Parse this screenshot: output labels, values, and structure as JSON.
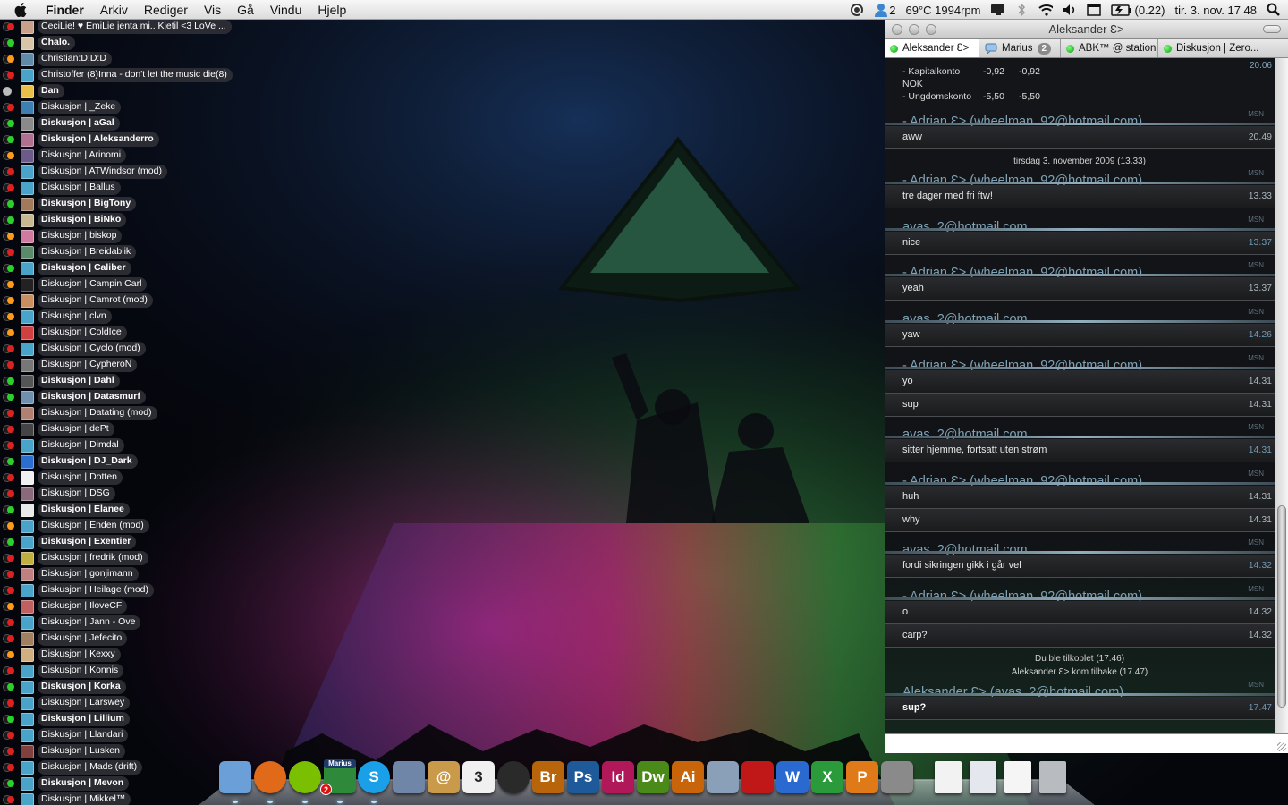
{
  "menubar": {
    "app_name": "Finder",
    "items": [
      "Arkiv",
      "Rediger",
      "Vis",
      "Gå",
      "Vindu",
      "Hjelp"
    ],
    "status": {
      "messages_count": "2",
      "temperature": "69°C 1994rpm",
      "battery": "(0.22)",
      "clock": "tir. 3. nov.  17 48"
    }
  },
  "buddies": [
    {
      "name": "CeciLie! ♥ EmiLie jenta mi.. Kjetil <3 LoVe ...",
      "status": "busy",
      "avatar": "#c9a18a"
    },
    {
      "name": "Chalo.",
      "status": "available",
      "bold": true,
      "avatar": "#d8c4a8"
    },
    {
      "name": "Christian:D:D:D",
      "status": "away",
      "avatar": "#5f8aa8"
    },
    {
      "name": "Christoffer (8)Inna - don't let the music die(8)",
      "status": "busy",
      "avatar": "#4aa3c9"
    },
    {
      "name": "Dan",
      "status": "offline",
      "bold": true,
      "avatar": "#e8c04a"
    },
    {
      "name": "Diskusjon | _Zeke",
      "status": "busy",
      "avatar": "#3d7fb0"
    },
    {
      "name": "Diskusjon | aGal",
      "status": "available",
      "bold": true,
      "avatar": "#8a8a8a"
    },
    {
      "name": "Diskusjon | Aleksanderro",
      "status": "available",
      "bold": true,
      "avatar": "#b07090"
    },
    {
      "name": "Diskusjon | Arinomi",
      "status": "away",
      "avatar": "#6b5a8a"
    },
    {
      "name": "Diskusjon | ATWindsor (mod)",
      "status": "busy",
      "avatar": "#4aa3c9"
    },
    {
      "name": "Diskusjon | Ballus",
      "status": "busy",
      "avatar": "#4aa3c9"
    },
    {
      "name": "Diskusjon | BigTony",
      "status": "available",
      "bold": true,
      "avatar": "#a07a5a"
    },
    {
      "name": "Diskusjon | BiNko",
      "status": "available",
      "bold": true,
      "avatar": "#c8b890"
    },
    {
      "name": "Diskusjon | biskop",
      "status": "away",
      "avatar": "#d07aa0"
    },
    {
      "name": "Diskusjon | Breidablik",
      "status": "busy",
      "avatar": "#5a8a6a"
    },
    {
      "name": "Diskusjon | Caliber",
      "status": "available",
      "bold": true,
      "avatar": "#4aa3c9"
    },
    {
      "name": "Diskusjon | Campin Carl",
      "status": "away",
      "avatar": "#222222"
    },
    {
      "name": "Diskusjon | Camrot (mod)",
      "status": "away",
      "avatar": "#c89060"
    },
    {
      "name": "Diskusjon | clvn",
      "status": "away",
      "avatar": "#4aa3c9"
    },
    {
      "name": "Diskusjon | ColdIce",
      "status": "away",
      "avatar": "#d04040"
    },
    {
      "name": "Diskusjon | Cyclo (mod)",
      "status": "busy",
      "avatar": "#4aa3c9"
    },
    {
      "name": "Diskusjon | CypheroN",
      "status": "busy",
      "avatar": "#777777"
    },
    {
      "name": "Diskusjon | Dahl",
      "status": "available",
      "bold": true,
      "avatar": "#555555"
    },
    {
      "name": "Diskusjon | Datasmurf",
      "status": "available",
      "bold": true,
      "avatar": "#7090b0"
    },
    {
      "name": "Diskusjon | Datating (mod)",
      "status": "busy",
      "avatar": "#b08070"
    },
    {
      "name": "Diskusjon | dePt",
      "status": "busy",
      "avatar": "#444444"
    },
    {
      "name": "Diskusjon | Dimdal",
      "status": "busy",
      "avatar": "#4aa3c9"
    },
    {
      "name": "Diskusjon | DJ_Dark",
      "status": "available",
      "bold": true,
      "avatar": "#2a6fd0"
    },
    {
      "name": "Diskusjon | Dotten",
      "status": "busy",
      "avatar": "#f0f0f0"
    },
    {
      "name": "Diskusjon | DSG",
      "status": "busy",
      "avatar": "#8a6a7a"
    },
    {
      "name": "Diskusjon | Elanee",
      "status": "available",
      "bold": true,
      "avatar": "#e8e8e8"
    },
    {
      "name": "Diskusjon | Enden (mod)",
      "status": "away",
      "avatar": "#4aa3c9"
    },
    {
      "name": "Diskusjon | Exentier",
      "status": "available",
      "bold": true,
      "avatar": "#4aa3c9"
    },
    {
      "name": "Diskusjon | fredrik (mod)",
      "status": "busy",
      "avatar": "#c0b040"
    },
    {
      "name": "Diskusjon | gonjimann",
      "status": "busy",
      "avatar": "#c08080"
    },
    {
      "name": "Diskusjon | Heilage (mod)",
      "status": "busy",
      "avatar": "#4aa3c9"
    },
    {
      "name": "Diskusjon | IloveCF",
      "status": "away",
      "avatar": "#c06060"
    },
    {
      "name": "Diskusjon | Jann - Ove",
      "status": "busy",
      "avatar": "#4aa3c9"
    },
    {
      "name": "Diskusjon | Jefecito",
      "status": "busy",
      "avatar": "#a08060"
    },
    {
      "name": "Diskusjon | Kexxy",
      "status": "away",
      "avatar": "#d0b080"
    },
    {
      "name": "Diskusjon | Konnis",
      "status": "busy",
      "avatar": "#4aa3c9"
    },
    {
      "name": "Diskusjon | Korka",
      "status": "available",
      "bold": true,
      "avatar": "#4aa3c9"
    },
    {
      "name": "Diskusjon | Larswey",
      "status": "busy",
      "avatar": "#4aa3c9"
    },
    {
      "name": "Diskusjon | Lillium",
      "status": "available",
      "bold": true,
      "avatar": "#4aa3c9"
    },
    {
      "name": "Diskusjon | Llandari",
      "status": "busy",
      "avatar": "#4aa3c9"
    },
    {
      "name": "Diskusjon | Lusken",
      "status": "busy",
      "avatar": "#804040"
    },
    {
      "name": "Diskusjon | Mads (drift)",
      "status": "busy",
      "avatar": "#4aa3c9"
    },
    {
      "name": "Diskusjon | Mevon",
      "status": "available",
      "bold": true,
      "avatar": "#4aa3c9"
    },
    {
      "name": "Diskusjon | Mikkel™",
      "status": "busy",
      "avatar": "#4aa3c9"
    }
  ],
  "status_colors": {
    "available": "#2bd12b",
    "away": "#ff9a1a",
    "busy": "#e02020",
    "offline": "#8a8a8a"
  },
  "chat": {
    "title": "Aleksander Ɛ>",
    "tabs": [
      {
        "label": "Aleksander Ɛ>",
        "active": true,
        "icon": "status-dot"
      },
      {
        "label": "Marius",
        "badge": "2",
        "icon": "speech-bubble-icon"
      },
      {
        "label": "ABK™ @ station",
        "icon": "status-dot"
      },
      {
        "label": "Diskusjon | Zero...",
        "icon": "status-dot"
      }
    ],
    "account_rows": [
      {
        "label": "- Kapitalkonto",
        "a": "-0,92",
        "b": "-0,92"
      },
      {
        "label": "NOK",
        "a": "",
        "b": ""
      },
      {
        "label": "- Ungdomskonto",
        "a": "-5,50",
        "b": "-5,50"
      }
    ],
    "first_time": "20.06",
    "date_divider": "tirsdag 3. november 2009 (13.33)",
    "protocol": "MSN",
    "sender_adrian": "- Adrian Ɛ> (wheelman_92@hotmail.com)",
    "sender_avas": "avas_2@hotmail.com",
    "sender_aleksander": "Aleksander Ɛ> (avas_2@hotmail.com)",
    "messages": [
      {
        "text": "aww",
        "time": "20.49"
      },
      {
        "text": "tre dager med fri ftw!",
        "time": "13.33"
      },
      {
        "text": "nice",
        "time": "13.37"
      },
      {
        "text": "yeah",
        "time": "13.37"
      },
      {
        "text": "yaw",
        "time": "14.26"
      },
      {
        "text": "yo",
        "time": "14.31"
      },
      {
        "text": "sup",
        "time": "14.31"
      },
      {
        "text": "sitter hjemme, fortsatt uten strøm",
        "time": "14.31"
      },
      {
        "text": "huh",
        "time": "14.31"
      },
      {
        "text": "why",
        "time": "14.31"
      },
      {
        "text": "fordi sikringen gikk i går vel",
        "time": "14.32"
      },
      {
        "text": "o",
        "time": "14.32"
      },
      {
        "text": "carp?",
        "time": "14.32"
      },
      {
        "text": "sup?",
        "time": "17.47"
      }
    ],
    "status_connected": "Du ble tilkoblet (17.46)",
    "status_back": "Aleksander Ɛ> kom tilbake (17.47)",
    "input_value": ""
  },
  "dock": {
    "apps": [
      {
        "name": "finder-icon",
        "label": "",
        "color": "#6a9fd8"
      },
      {
        "name": "firefox-icon",
        "label": "",
        "color": "#e06a1a"
      },
      {
        "name": "spotify-icon",
        "label": "",
        "color": "#7ac000"
      },
      {
        "name": "adium-icon",
        "label": "",
        "color": "#2e8a3a",
        "caption": "Marius",
        "badge": "2"
      },
      {
        "name": "skype-icon",
        "label": "S",
        "color": "#1aa0e8"
      },
      {
        "name": "preview-icon",
        "label": "",
        "color": "#6f86a8"
      },
      {
        "name": "address-book-icon",
        "label": "@",
        "color": "#c99a4a"
      },
      {
        "name": "ical-icon",
        "label": "3",
        "color": "#f0f0f0"
      },
      {
        "name": "aperture-icon",
        "label": "",
        "color": "#2a2a2a"
      },
      {
        "name": "bridge-icon",
        "label": "Br",
        "color": "#b8640a"
      },
      {
        "name": "photoshop-icon",
        "label": "Ps",
        "color": "#1e5a9a"
      },
      {
        "name": "indesign-icon",
        "label": "Id",
        "color": "#b0185a"
      },
      {
        "name": "dreamweaver-icon",
        "label": "Dw",
        "color": "#4a8a18"
      },
      {
        "name": "illustrator-icon",
        "label": "Ai",
        "color": "#c8640a"
      },
      {
        "name": "iphoto-icon",
        "label": "",
        "color": "#8aa0b8"
      },
      {
        "name": "photo-booth-icon",
        "label": "",
        "color": "#c01818"
      },
      {
        "name": "word-icon",
        "label": "W",
        "color": "#2a6ad0"
      },
      {
        "name": "excel-icon",
        "label": "X",
        "color": "#2a9a3a"
      },
      {
        "name": "powerpoint-icon",
        "label": "P",
        "color": "#e07a18"
      },
      {
        "name": "system-preferences-icon",
        "label": "",
        "color": "#8a8a8a"
      },
      {
        "name": "pdf-document-icon",
        "label": "",
        "color": "#f2f2f2"
      },
      {
        "name": "rtf-document-icon",
        "label": "",
        "color": "#e4e8ee"
      },
      {
        "name": "blank-document-icon",
        "label": "",
        "color": "#f5f5f5"
      },
      {
        "name": "trash-icon",
        "label": "",
        "color": "#b8bcc0"
      }
    ]
  }
}
